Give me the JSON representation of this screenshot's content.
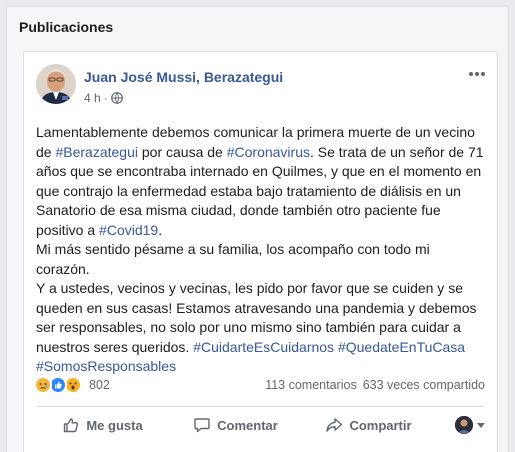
{
  "section": {
    "title": "Publicaciones"
  },
  "post": {
    "author": "Juan José Mussi, Berazategui",
    "time": "4 h",
    "separator": "·",
    "icons": {
      "privacy": "globe-icon",
      "more": "more-options-icon"
    },
    "body": {
      "l1": "Lamentablemente debemos comunicar la primera muerte de un vecino",
      "l2_a": "de ",
      "l2_tag1": "#Berazategui",
      "l2_b": " por causa de ",
      "l2_tag2": "#Coronavirus",
      "l2_c": ". Se trata de un señor de 71",
      "l3": "años que se encontraba internado en Quilmes, y que en el momento en",
      "l4": "que contrajo la enfermedad estaba bajo tratamiento de diálisis en un",
      "l5": "Sanatorio de esa misma ciudad, donde también otro paciente fue",
      "l6_a": "positivo a ",
      "l6_tag": "#Covid19",
      "l6_b": ".",
      "l7": "Mi más sentido pésame a su familia, los acompaño con todo mi",
      "l8": "corazón.",
      "l9": "Y a ustedes, vecinos y vecinas, les pido por favor que se cuiden y se",
      "l10": "queden en sus casas! Estamos atravesando una pandemia y debemos",
      "l11": "ser responsables, no solo por uno mismo sino también para cuidar a",
      "l12_a": "nuestros seres queridos. ",
      "l12_tag1": "#CuidarteEsCuidarnos",
      "l12_tag2": "#QuedateEnTuCasa",
      "l13_tag": "#SomosResponsables"
    },
    "stats": {
      "reaction_count": "802",
      "reaction_icons": [
        "sad-reaction-icon",
        "like-reaction-icon",
        "wow-reaction-icon"
      ],
      "comments": "113 comentarios",
      "shares": "633 veces compartido"
    },
    "actions": {
      "like": "Me gusta",
      "comment": "Comentar",
      "share": "Compartir"
    }
  },
  "colors": {
    "link": "#385898",
    "background": "#e9ebee",
    "like_blue": "#2e89ff",
    "reaction_yellow": "#f5b63a"
  }
}
